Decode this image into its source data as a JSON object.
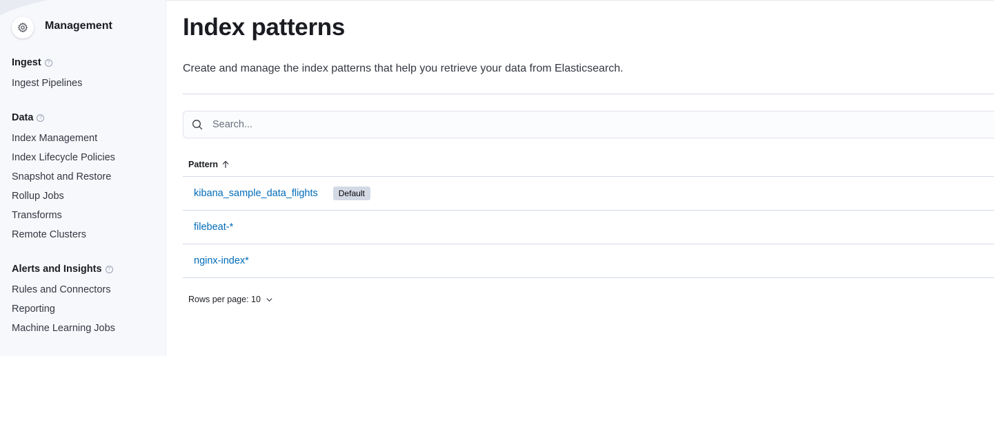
{
  "sidebar": {
    "title": "Management",
    "groups": [
      {
        "title": "Ingest",
        "items": [
          "Ingest Pipelines"
        ]
      },
      {
        "title": "Data",
        "items": [
          "Index Management",
          "Index Lifecycle Policies",
          "Snapshot and Restore",
          "Rollup Jobs",
          "Transforms",
          "Remote Clusters"
        ]
      },
      {
        "title": "Alerts and Insights",
        "items": [
          "Rules and Connectors",
          "Reporting",
          "Machine Learning Jobs"
        ]
      }
    ],
    "help_glyph": "?"
  },
  "main": {
    "title": "Index patterns",
    "description": "Create and manage the index patterns that help you retrieve your data from Elasticsearch.",
    "search": {
      "placeholder": "Search...",
      "value": ""
    },
    "table": {
      "columns": [
        "Pattern"
      ],
      "sort": "ascending",
      "rows": [
        {
          "pattern": "kibana_sample_data_flights",
          "badge": "Default"
        },
        {
          "pattern": "filebeat-*"
        },
        {
          "pattern": "nginx-index*"
        }
      ]
    },
    "pagination": {
      "rows_per_page_label": "Rows per page: 10"
    }
  },
  "colors": {
    "link": "#006bb8",
    "sidebar_bg": "#f7f8fc",
    "badge_bg": "#d3dae6"
  },
  "icons": {
    "management": "gear-icon",
    "search": "search-icon",
    "sort": "arrow-up-icon",
    "pagination": "chevron-down-icon"
  }
}
